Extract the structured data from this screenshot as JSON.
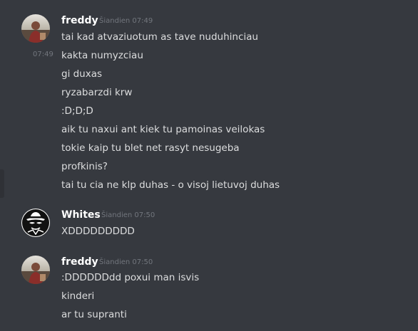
{
  "groups": [
    {
      "username": "freddy",
      "timestamp": "Šiandien 07:49",
      "hover_time": "07:49",
      "avatar_icon": "user-photo-avatar-icon",
      "messages": [
        "tai kad atvaziuotum as tave nuduhinciau",
        "kakta numyzciau",
        "gi duxas",
        "ryzabarzdi krw",
        ":D;D;D",
        "aik tu naxui ant kiek tu pamoinas veilokas",
        "tokie kaip tu blet net rasyt nesugeba",
        "profkinis?",
        "tai tu cia ne klp duhas - o visoj lietuvoj duhas"
      ]
    },
    {
      "username": "Whites",
      "timestamp": "Šiandien 07:50",
      "avatar_icon": "spy-fedora-avatar-icon",
      "messages": [
        "XDDDDDDDDD"
      ]
    },
    {
      "username": "freddy",
      "timestamp": "Šiandien 07:50",
      "avatar_icon": "user-photo-avatar-icon",
      "messages": [
        ":DDDDDDdd poxui man isvis",
        "kinderi",
        "ar tu supranti"
      ]
    }
  ],
  "colors": {
    "background": "#36393f",
    "username": "#ffffff",
    "message_text": "#dcddde",
    "timestamp": "#72767d"
  }
}
